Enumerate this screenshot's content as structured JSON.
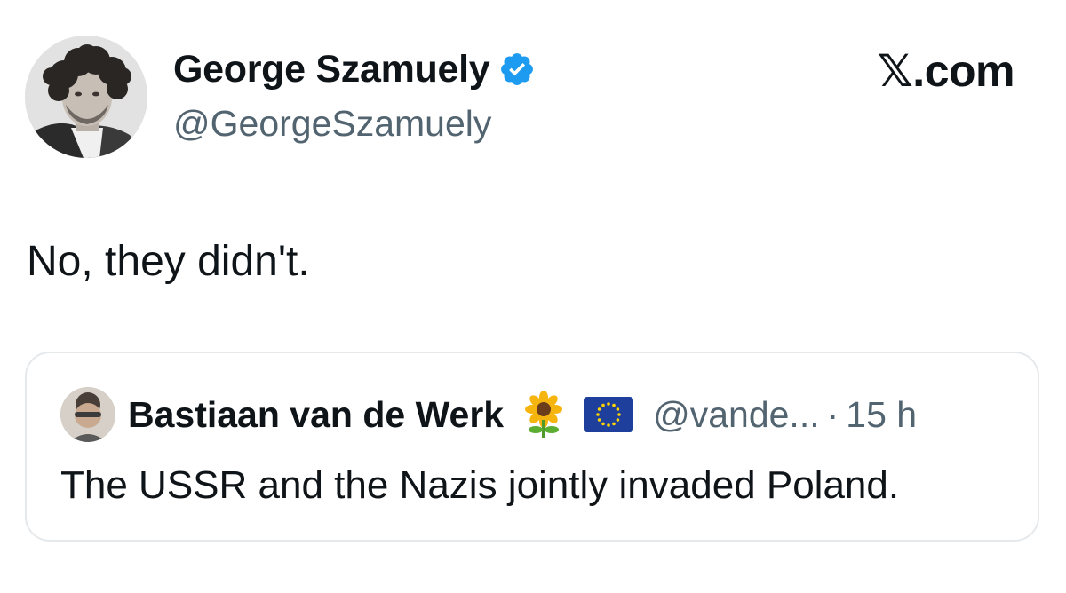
{
  "tweet": {
    "author": {
      "name": "George Szamuely",
      "handle": "@GeorgeSzamuely",
      "verified": true,
      "avatar_icon": "author-photo-avatar",
      "verified_color": "#1d9bf0"
    },
    "brand": "𝕏.com",
    "text": "No, they didn't."
  },
  "quote": {
    "author": {
      "name": "Bastiaan van de Werk",
      "handle": "@vande...",
      "avatar_icon": "quoted-author-avatar",
      "badges": [
        "sunflower-emoji",
        "eu-flag-emoji"
      ]
    },
    "separator": "·",
    "time": "15 h",
    "text": "The USSR and the Nazis jointly invaded Poland."
  },
  "colors": {
    "text_primary": "#0f1419",
    "text_secondary": "#536471",
    "card_border": "#e6e9ec",
    "verified_blue": "#1d9bf0"
  }
}
